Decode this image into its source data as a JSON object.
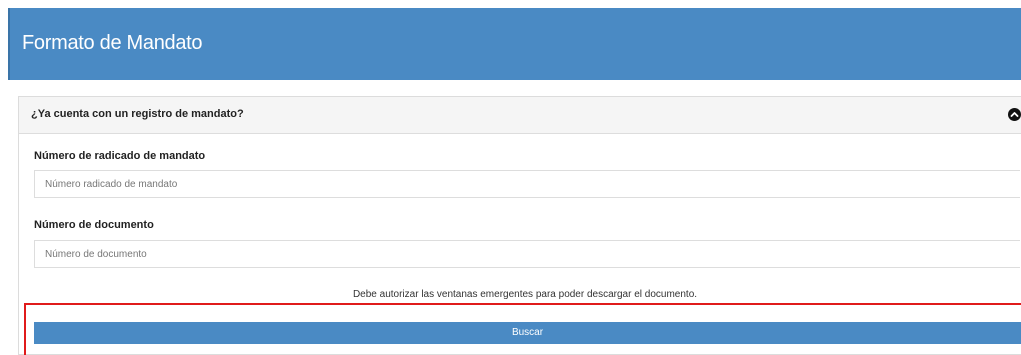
{
  "header": {
    "title": "Formato de Mandato"
  },
  "panel": {
    "title": "¿Ya cuenta con un registro de mandato?",
    "collapse_icon": "chevron-up-circle-icon"
  },
  "form": {
    "radicado": {
      "label": "Número de radicado de mandato",
      "placeholder": "Número radicado de mandato",
      "value": ""
    },
    "documento": {
      "label": "Número de documento",
      "placeholder": "Número de documento",
      "value": ""
    },
    "notice": "Debe autorizar las ventanas emergentes para poder descargar el documento.",
    "search_label": "Buscar"
  },
  "colors": {
    "header_bg": "#4a8ac4",
    "button_bg": "#4a8ac4",
    "highlight_border": "#e01b1b"
  }
}
